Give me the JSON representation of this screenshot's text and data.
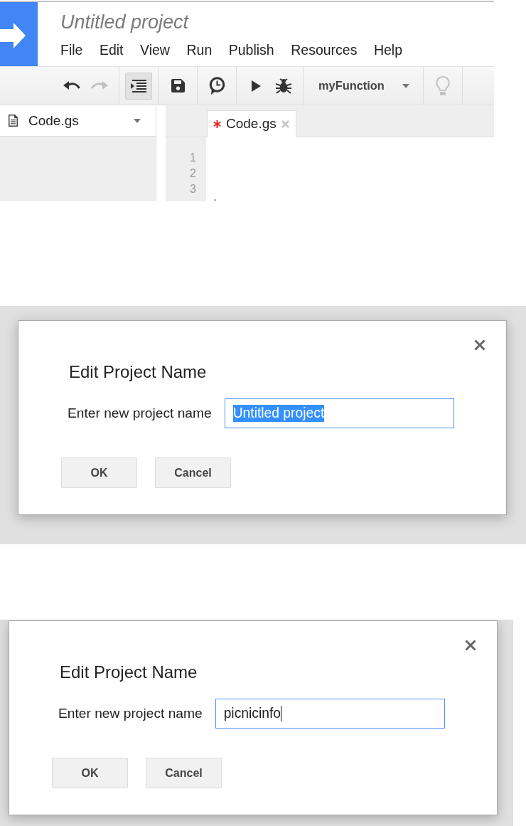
{
  "editor": {
    "title": "Untitled project",
    "menu": [
      "File",
      "Edit",
      "View",
      "Run",
      "Publish",
      "Resources",
      "Help"
    ],
    "toolbar": {
      "groups": [
        {
          "buttons": [
            {
              "kind": "undo",
              "disabled": false,
              "on": false
            },
            {
              "kind": "redo",
              "disabled": true,
              "on": false
            }
          ]
        },
        {
          "buttons": [
            {
              "kind": "indent",
              "disabled": false,
              "on": true
            }
          ]
        },
        {
          "buttons": [
            {
              "kind": "save",
              "disabled": false,
              "on": false
            }
          ]
        },
        {
          "buttons": [
            {
              "kind": "clock",
              "disabled": false,
              "on": false
            }
          ]
        },
        {
          "buttons": [
            {
              "kind": "run",
              "disabled": false,
              "on": false
            },
            {
              "kind": "debug",
              "disabled": false,
              "on": false
            }
          ]
        },
        {
          "buttons": [
            {
              "kind": "select",
              "label": "myFunction",
              "disabled": false,
              "on": false
            }
          ]
        },
        {
          "buttons": [
            {
              "kind": "hint",
              "disabled": true,
              "on": false
            }
          ]
        }
      ]
    },
    "sidebar": {
      "file": "Code.gs"
    },
    "tabs": [
      {
        "label": "Code.gs",
        "modified": true,
        "selected": true
      }
    ],
    "line_numbers": [
      "1",
      "2",
      "3"
    ]
  },
  "dialogs": [
    {
      "title": "Edit Project Name",
      "label": "Enter new project name",
      "value": "Untitled project",
      "text_selected": true,
      "buttons": [
        "OK",
        "Cancel"
      ]
    },
    {
      "title": "Edit Project Name",
      "label": "Enter new project name",
      "value": "picnicinfo",
      "text_selected": false,
      "buttons": [
        "OK",
        "Cancel"
      ]
    }
  ]
}
